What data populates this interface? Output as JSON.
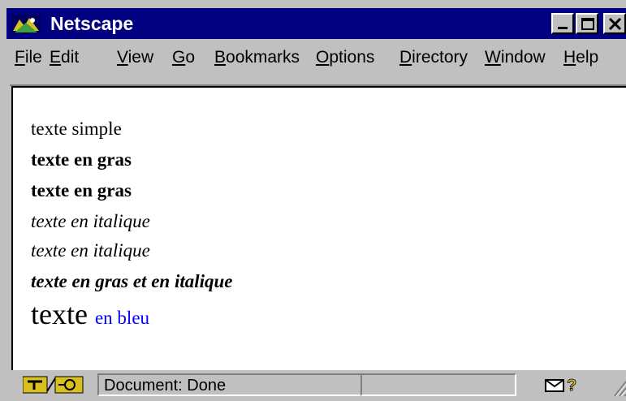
{
  "window": {
    "title": "Netscape",
    "colors": {
      "titlebar": "#000080",
      "chrome": "#c0c0c0",
      "link": "#0000ff"
    }
  },
  "menu": {
    "items": [
      {
        "label_u": "F",
        "label_rest": "ile"
      },
      {
        "label_u": "E",
        "label_rest": "dit"
      },
      {
        "label_u": "V",
        "label_rest": "iew"
      },
      {
        "label_u": "G",
        "label_rest": "o"
      },
      {
        "label_u": "B",
        "label_rest": "ookmarks"
      },
      {
        "label_u": "O",
        "label_rest": "ptions"
      },
      {
        "label_u": "D",
        "label_rest": "irectory"
      },
      {
        "label_u": "W",
        "label_rest": "indow"
      },
      {
        "label_u": "H",
        "label_rest": "elp"
      }
    ]
  },
  "content": {
    "lines": [
      "texte simple",
      "texte en gras",
      "texte en gras",
      "texte en italique",
      "texte en italique",
      "texte en gras et en italique"
    ],
    "big_word": "texte",
    "blue_text": "en bleu"
  },
  "status": {
    "text": "Document: Done",
    "icons": [
      "security-key-icon",
      "mail-icon",
      "question-icon",
      "resize-grip-icon"
    ]
  }
}
